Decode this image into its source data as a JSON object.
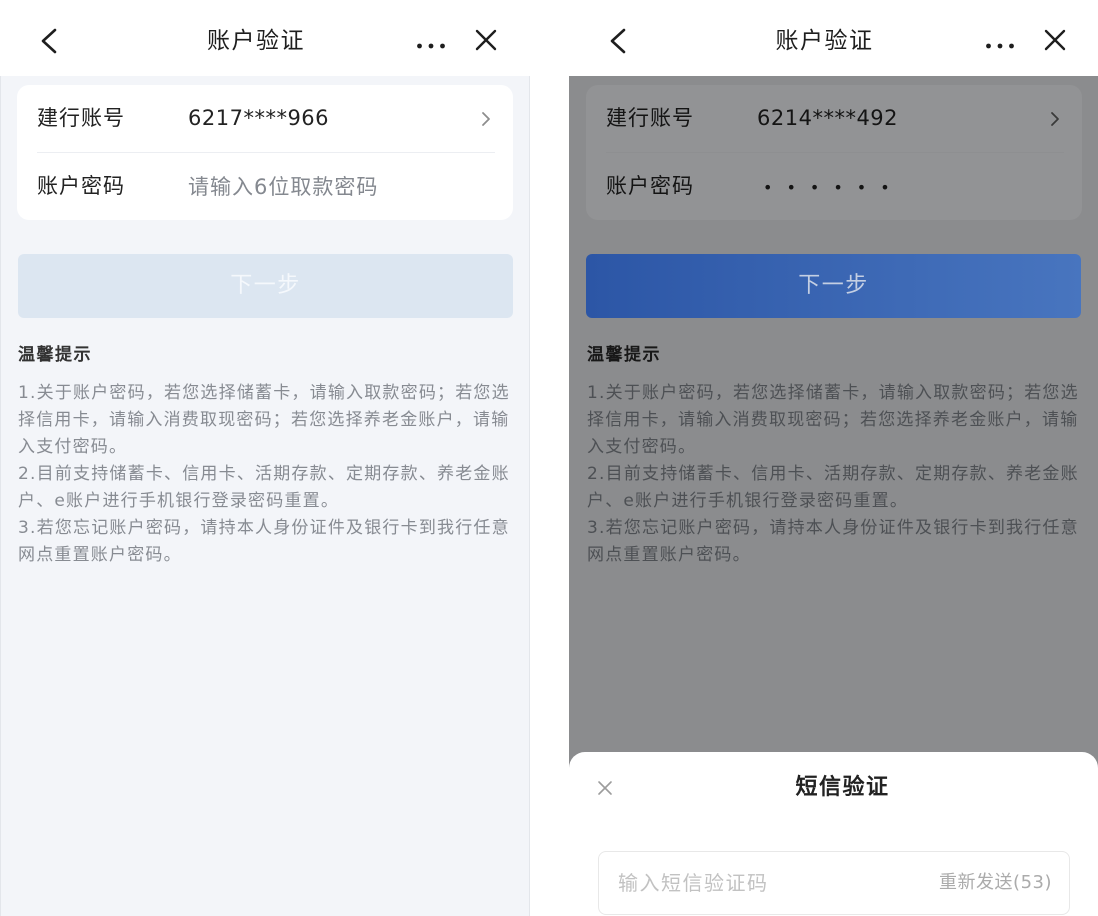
{
  "colors": {
    "page_bg": "#f3f5f9",
    "button_disabled": "#dce6f1",
    "accent_blue": "#4875bf"
  },
  "icons": {
    "back": "back-chevron-icon",
    "more": "more-dots-icon",
    "close": "close-icon",
    "enter": "chevron-right-icon",
    "sheet_close": "close-icon"
  },
  "screens": [
    {
      "header": {
        "title": "账户验证"
      },
      "account": {
        "label": "建行账号",
        "value": "6217****966"
      },
      "password": {
        "label": "账户密码",
        "placeholder": "请输入6位取款密码"
      },
      "next_label": "下一步",
      "tips_title": "温馨提示",
      "tips": [
        "1.关于账户密码，若您选择储蓄卡，请输入取款密码；若您选择信用卡，请输入消费取现密码；若您选择养老金账户，请输入支付密码。",
        "2.目前支持储蓄卡、信用卡、活期存款、定期存款、养老金账户、e账户进行手机银行登录密码重置。",
        "3.若您忘记账户密码，请持本人身份证件及银行卡到我行任意网点重置账户密码。"
      ]
    },
    {
      "header": {
        "title": "账户验证"
      },
      "account": {
        "label": "建行账号",
        "value": "6214****492"
      },
      "password": {
        "label": "账户密码",
        "masked_value": "••••••"
      },
      "next_label": "下一步",
      "tips_title": "温馨提示",
      "tips": [
        "1.关于账户密码，若您选择储蓄卡，请输入取款密码；若您选择信用卡，请输入消费取现密码；若您选择养老金账户，请输入支付密码。",
        "2.目前支持储蓄卡、信用卡、活期存款、定期存款、养老金账户、e账户进行手机银行登录密码重置。",
        "3.若您忘记账户密码，请持本人身份证件及银行卡到我行任意网点重置账户密码。"
      ],
      "sms_sheet": {
        "title": "短信验证",
        "placeholder": "输入短信验证码",
        "resend_label": "重新发送(53)"
      }
    }
  ]
}
